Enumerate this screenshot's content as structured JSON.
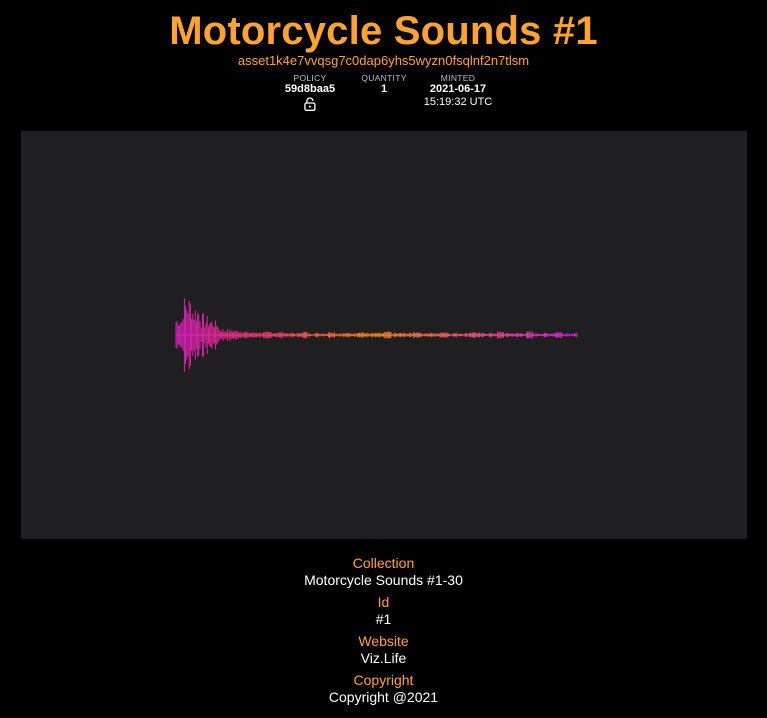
{
  "header": {
    "title": "Motorcycle Sounds #1",
    "asset_id": "asset1k4e7vvqsg7c0dap6yhs5wyzn0fsqlnf2n7tlsm"
  },
  "meta": {
    "policy_label": "POLICY",
    "policy_value": "59d8baa5",
    "quantity_label": "QUANTITY",
    "quantity_value": "1",
    "minted_label": "MINTED",
    "minted_date": "2021-06-17",
    "minted_time": "15:19:32 UTC",
    "lock_icon": "lock-icon"
  },
  "player": {
    "waveform_colors": [
      "#e81ec8",
      "#f0327a",
      "#ff8a1e",
      "#d81ee0"
    ]
  },
  "details": [
    {
      "label": "Collection",
      "value": "Motorcycle Sounds #1-30"
    },
    {
      "label": "Id",
      "value": "#1"
    },
    {
      "label": "Website",
      "value": "Viz.Life"
    },
    {
      "label": "Copyright",
      "value": "Copyright @2021"
    }
  ],
  "colors": {
    "accent": "#ffa52f",
    "background": "#000000",
    "panel": "#1f1e21"
  }
}
